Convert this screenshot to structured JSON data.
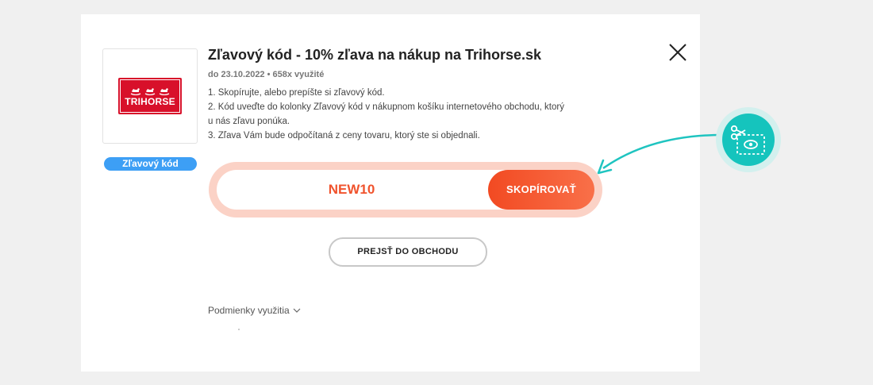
{
  "store": {
    "logo_text": "TRIHORSE",
    "badge_label": "Zľavový kód"
  },
  "offer": {
    "title": "Zľavový kód - 10% zľava na nákup na Trihorse.sk",
    "meta": "do 23.10.2022 • 658x využité",
    "instructions": [
      "1. Skopírujte, alebo prepíšte si zľavový kód.",
      "2. Kód uveďte do kolonky Zľavový kód v nákupnom košíku internetového obchodu, ktorý u nás zľavu ponúka.",
      "3. Zľava Vám bude odpočítaná z ceny tovaru, ktorý ste si objednali."
    ]
  },
  "code": {
    "value": "NEW10",
    "copy_label": "SKOPÍROVAŤ"
  },
  "actions": {
    "store_button": "PREJSŤ DO OBCHODU",
    "terms_label": "Podmienky využitia"
  },
  "icons": {
    "close": "close-icon",
    "terms_toggle": "chevron-down-icon",
    "coupon": "scissors-coupon-icon",
    "arrow": "curved-arrow-icon"
  },
  "colors": {
    "accent": "#f24a22",
    "badge": "#3d9ff5",
    "teal": "#15c4bd",
    "logo_red": "#d8102a"
  }
}
